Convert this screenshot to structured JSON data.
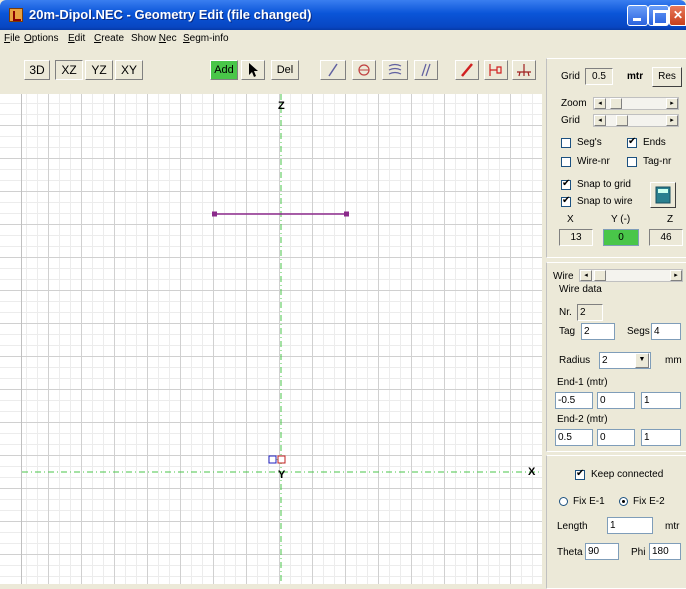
{
  "window": {
    "title": "20m-Dipol.NEC - Geometry Edit (file changed)"
  },
  "menu": [
    {
      "prefix": "",
      "accel": "F",
      "rest": "ile"
    },
    {
      "prefix": "",
      "accel": "O",
      "rest": "ptions"
    },
    {
      "prefix": "",
      "accel": "E",
      "rest": "dit"
    },
    {
      "prefix": "",
      "accel": "C",
      "rest": "reate"
    },
    {
      "prefix": "Show ",
      "accel": "N",
      "rest": "ec"
    },
    {
      "prefix": "",
      "accel": "S",
      "rest": "egm-info"
    }
  ],
  "toolbar": {
    "view_3d": "3D",
    "view_xz": "XZ",
    "view_yz": "YZ",
    "view_xy": "XY",
    "add": "Add",
    "del": "Del"
  },
  "canvas": {
    "z_label": "Z",
    "y_label": "Y",
    "x_label": "X"
  },
  "panel": {
    "grid_label": "Grid",
    "grid_value": "0.5",
    "grid_unit": "mtr",
    "res_button": "Res",
    "zoom_label": "Zoom",
    "grid_slider_label": "Grid",
    "segs_label": "Seg's",
    "segs_checked": false,
    "ends_label": "Ends",
    "ends_checked": true,
    "wirenr_label": "Wire-nr",
    "wirenr_checked": false,
    "tagnr_label": "Tag-nr",
    "tagnr_checked": false,
    "snap_grid_label": "Snap to grid",
    "snap_grid_checked": true,
    "snap_wire_label": "Snap to wire",
    "snap_wire_checked": true,
    "x_header": "X",
    "y_header": "Y (-)",
    "z_header": "Z",
    "x_value": "13",
    "y_value": "0",
    "z_value": "46"
  },
  "wire": {
    "wire_label": "Wire",
    "wire_data_label": "Wire data",
    "nr_label": "Nr.",
    "nr_value": "2",
    "tag_label": "Tag",
    "tag_value": "2",
    "segs_label": "Segs",
    "segs_value": "4",
    "radius_label": "Radius",
    "radius_value": "2",
    "radius_unit": "mm",
    "end1_label": "End-1 (mtr)",
    "end1": [
      "-0.5",
      "0",
      "1"
    ],
    "end2_label": "End-2 (mtr)",
    "end2": [
      "0.5",
      "0",
      "1"
    ]
  },
  "bottom": {
    "keep_label": "Keep connected",
    "keep_checked": true,
    "fixe1_label": "Fix E-1",
    "fixe2_label": "Fix E-2",
    "length_label": "Length",
    "length_value": "1",
    "length_unit": "mtr",
    "theta_label": "Theta",
    "theta_value": "90",
    "phi_label": "Phi",
    "phi_value": "180"
  },
  "colors": {
    "wire": "#8b2a8b",
    "axis": "#49c649",
    "titlebar": "#0a55d8",
    "add_button": "#49c649"
  },
  "icons": [
    "app-icon",
    "minimize-icon",
    "maximize-icon",
    "close-icon",
    "pointer-arrow-icon",
    "line-tool-icon",
    "circle-tool-icon",
    "helix-tool-icon",
    "parallel-wires-icon",
    "pencil-icon",
    "source-icon",
    "ground-icon",
    "calculator-icon"
  ]
}
